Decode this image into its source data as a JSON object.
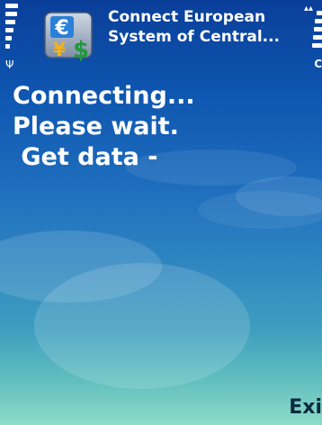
{
  "app": {
    "title_line1": "Connect European",
    "title_line2": "System of Central...",
    "icon": "currency-exchange-icon"
  },
  "status": {
    "signal_icon": "signal-strength-icon",
    "battery_icon": "battery-level-icon",
    "antenna_glyph": "Ψ",
    "right_indicator": "C"
  },
  "content": {
    "line1": "Connecting...",
    "line2": "Please wait.",
    "line3": " Get data -"
  },
  "softkeys": {
    "right": "Exi"
  },
  "colors": {
    "background_top": "#0a3f9a",
    "background_bottom": "#8edbc7",
    "text": "#ffffff",
    "softkey_text": "#0a2a40"
  }
}
